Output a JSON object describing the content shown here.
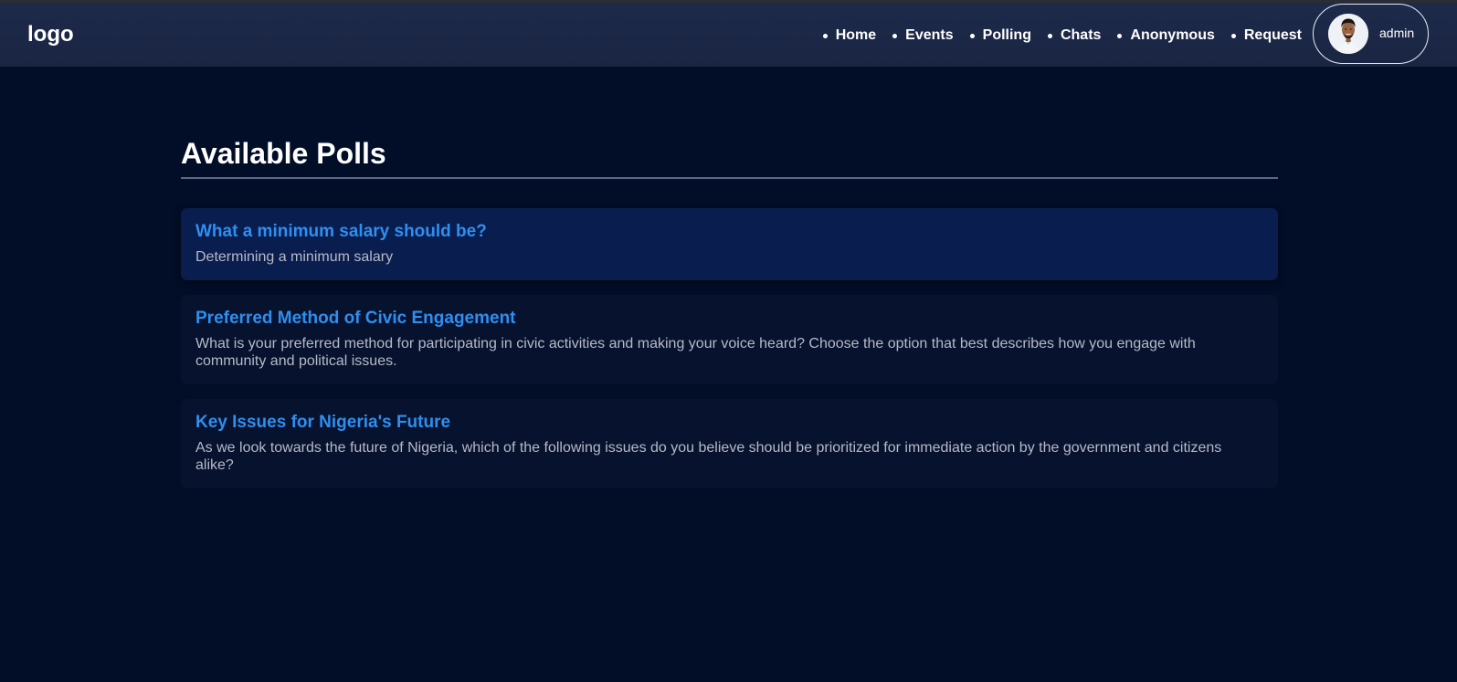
{
  "header": {
    "logo": "logo",
    "nav": [
      {
        "label": "Home"
      },
      {
        "label": "Events"
      },
      {
        "label": "Polling"
      },
      {
        "label": "Chats"
      },
      {
        "label": "Anonymous"
      },
      {
        "label": "Request"
      }
    ],
    "user": {
      "name": "admin",
      "avatar_icon": "user-avatar-photo"
    }
  },
  "main": {
    "title": "Available Polls",
    "polls": [
      {
        "title": "What a minimum salary should be?",
        "description": "Determining a minimum salary"
      },
      {
        "title": "Preferred Method of Civic Engagement",
        "description": "What is your preferred method for participating in civic activities and making your voice heard? Choose the option that best describes how you engage with community and political issues."
      },
      {
        "title": "Key Issues for Nigeria's Future",
        "description": "As we look towards the future of Nigeria, which of the following issues do you believe should be prioritized for immediate action by the government and citizens alike?"
      }
    ]
  },
  "colors": {
    "background": "#020e28",
    "navbar": "#1d2a4a",
    "accent": "#2e8ff0",
    "card": "#06122e",
    "card_active": "#0a1d4f"
  }
}
